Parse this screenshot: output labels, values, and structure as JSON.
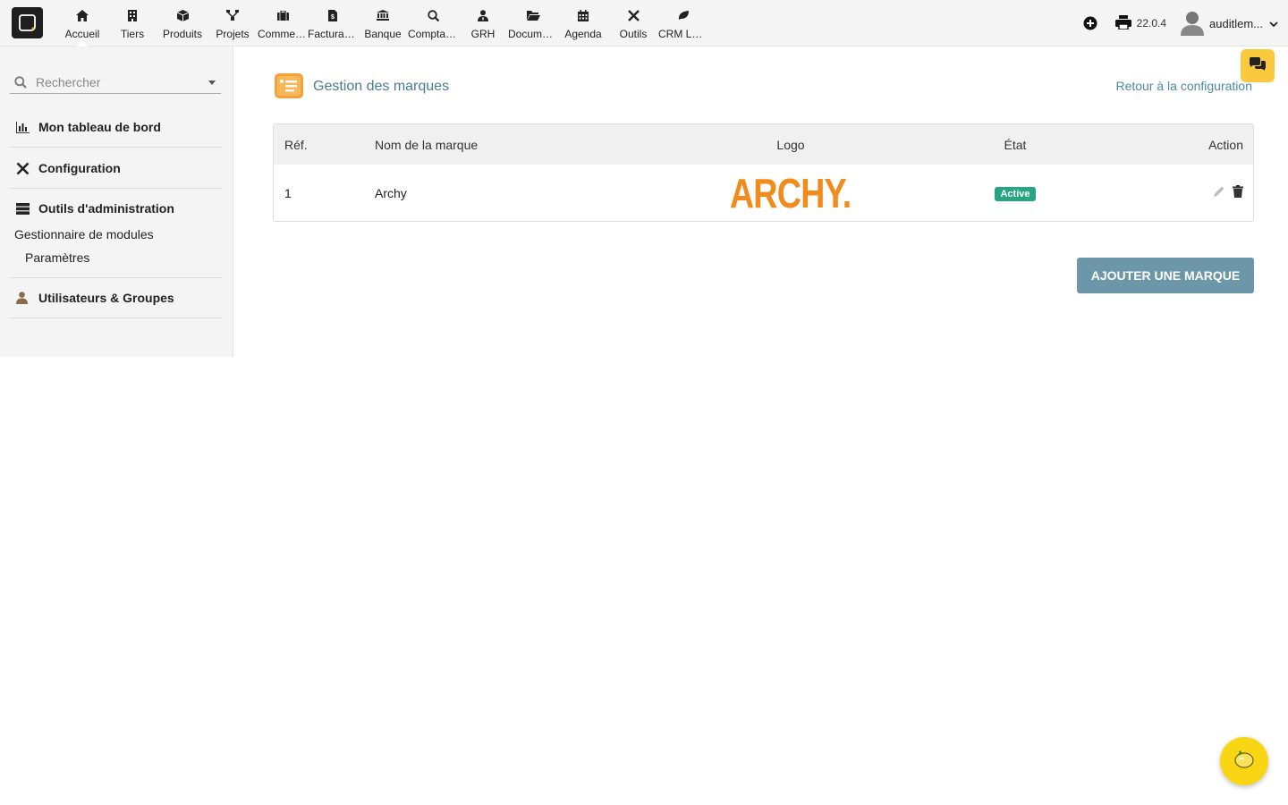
{
  "topbar": {
    "menu": [
      {
        "label": "Accueil",
        "icon": "home-icon"
      },
      {
        "label": "Tiers",
        "icon": "building-icon"
      },
      {
        "label": "Produits",
        "icon": "cube-icon"
      },
      {
        "label": "Projets",
        "icon": "sitemap-icon"
      },
      {
        "label": "Commercial",
        "icon": "suitcase-icon"
      },
      {
        "label": "Facturation",
        "icon": "invoice-icon"
      },
      {
        "label": "Banque",
        "icon": "bank-icon"
      },
      {
        "label": "Comptabilité",
        "icon": "search-dollar-icon"
      },
      {
        "label": "GRH",
        "icon": "user-tie-icon"
      },
      {
        "label": "Documents",
        "icon": "folder-icon"
      },
      {
        "label": "Agenda",
        "icon": "calendar-icon"
      },
      {
        "label": "Outils",
        "icon": "tools-icon"
      },
      {
        "label": "CRM Lead",
        "icon": "leaf-icon"
      }
    ],
    "version": "22.0.4",
    "username": "auditlem..."
  },
  "sidebar": {
    "search_placeholder": "Rechercher",
    "sections": {
      "dashboard": "Mon tableau de bord",
      "config": "Configuration",
      "admin": "Outils d'administration",
      "admin_sub1": "Gestionnaire de modules",
      "admin_sub2": "Paramètres",
      "users": "Utilisateurs & Groupes"
    }
  },
  "main": {
    "title": "Gestion des marques",
    "back_link": "Retour à la configuration",
    "table": {
      "headers": {
        "ref": "Réf.",
        "name": "Nom de la marque",
        "logo": "Logo",
        "etat": "État",
        "action": "Action"
      },
      "rows": [
        {
          "ref": "1",
          "name": "Archy",
          "logo_text": "ARCHY.",
          "status": "Active"
        }
      ]
    },
    "add_button": "AJOUTER UNE MARQUE"
  },
  "colors": {
    "accent": "#4b7d92",
    "brand_orange": "#f08b1c",
    "status_green": "#25a580",
    "button": "#6c97a8",
    "chat_yellow": "#fbc93d"
  }
}
